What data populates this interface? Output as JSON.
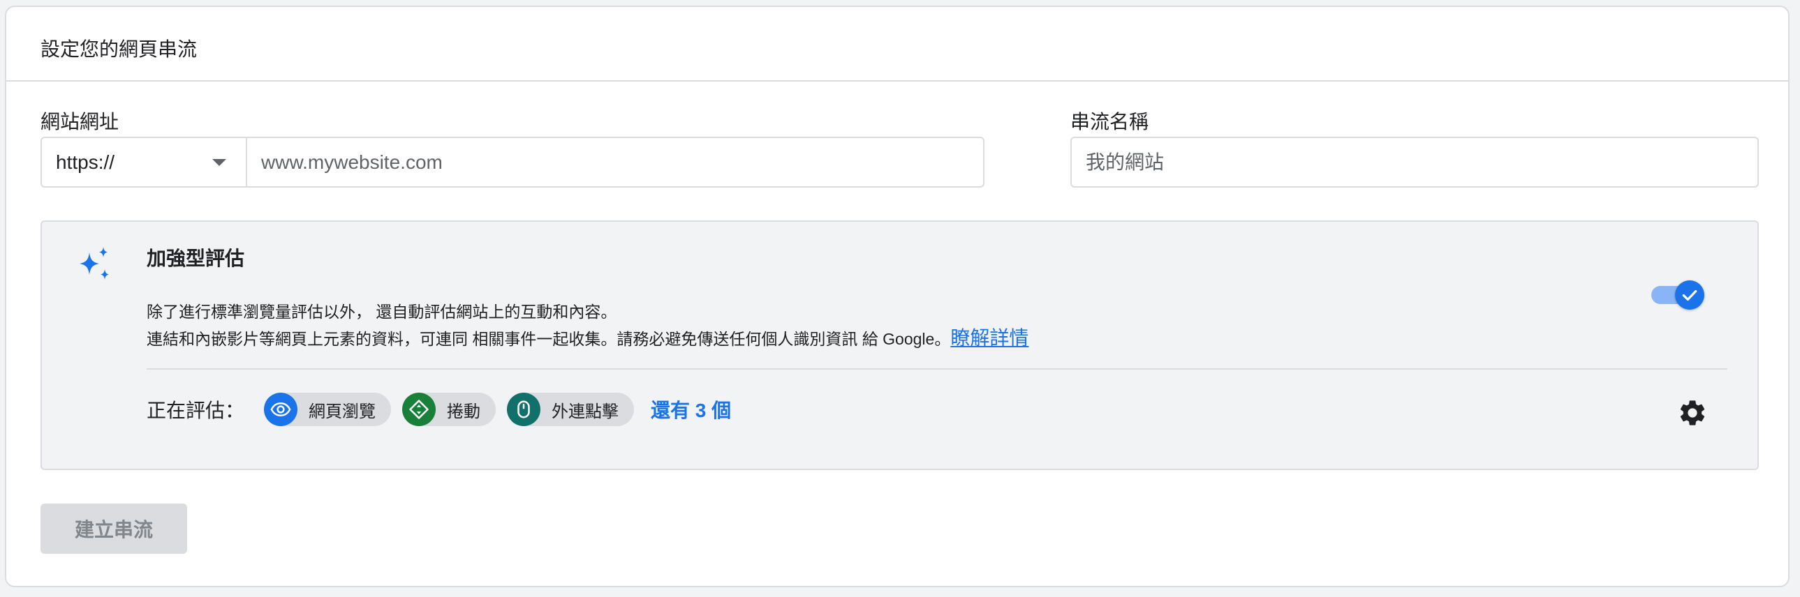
{
  "card": {
    "title": "設定您的網頁串流"
  },
  "url_field": {
    "label": "網站網址",
    "protocol": "https://",
    "placeholder": "www.mywebsite.com"
  },
  "name_field": {
    "label": "串流名稱",
    "placeholder": "我的網站"
  },
  "enhanced": {
    "title": "加強型評估",
    "desc_line1": "除了進行標準瀏覽量評估以外， 還自動評估網站上的互動和內容。",
    "desc_line2": "連結和內嵌影片等網頁上元素的資料，可連同 相關事件一起收集。請務必避免傳送任何個人識別資訊 給 Google。",
    "learn_more": "瞭解詳情",
    "toggle_on": true,
    "measuring_label": "正在評估：",
    "chips": [
      {
        "label": "網頁瀏覽",
        "icon": "eye-icon",
        "color": "#1a73e8"
      },
      {
        "label": "捲動",
        "icon": "scroll-icon",
        "color": "#188038"
      },
      {
        "label": "外連點擊",
        "icon": "mouse-icon",
        "color": "#12706a"
      }
    ],
    "more": "還有 3 個"
  },
  "create_button": "建立串流",
  "colors": {
    "accent": "#1a73e8",
    "border": "#dadce0",
    "panel_bg": "#f1f3f4"
  }
}
